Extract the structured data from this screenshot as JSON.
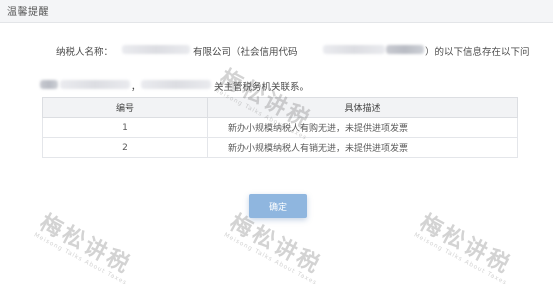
{
  "dialog": {
    "title": "温馨提醒",
    "message": {
      "taxpayer_name_label": "纳税人名称：",
      "company_fragment": "有限公司（社会信用代码",
      "tail_line1": "）的以下信息存在以下问",
      "line2_fragment": "，",
      "line2_tail": "关主管税务机关联系。"
    },
    "table": {
      "headers": [
        "编号",
        "具体描述"
      ],
      "rows": [
        {
          "no": "1",
          "desc": "新办小规模纳税人有购无进，未提供进项发票"
        },
        {
          "no": "2",
          "desc": "新办小规模纳税人有销无进，未提供进项发票"
        }
      ]
    },
    "ok_button": "确定"
  },
  "watermark": {
    "text": "梅松讲税",
    "subtext": "Meisong Talks About Taxes"
  }
}
